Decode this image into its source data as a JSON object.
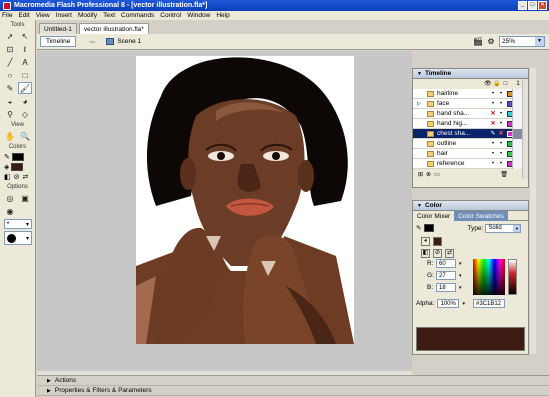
{
  "window": {
    "title": "Macromedia Flash Professional 8 - [vector illustration.fla*]"
  },
  "menu": [
    "File",
    "Edit",
    "View",
    "Insert",
    "Modify",
    "Text",
    "Commands",
    "Control",
    "Window",
    "Help"
  ],
  "tools": {
    "label": "Tools",
    "view_label": "View",
    "colors_label": "Colors",
    "options_label": "Options"
  },
  "doc_tabs": [
    {
      "label": "Untitled-1"
    },
    {
      "label": "vector illustration.fla*"
    }
  ],
  "edit_bar": {
    "timeline_button": "Timeline",
    "scene": "Scene 1",
    "zoom": "25%"
  },
  "timeline": {
    "title": "Timeline",
    "layers": [
      {
        "name": "hairline"
      },
      {
        "name": "face"
      },
      {
        "name": "hand sha..."
      },
      {
        "name": "hand hig..."
      },
      {
        "name": "chest sha..."
      },
      {
        "name": "outline"
      },
      {
        "name": "hair"
      },
      {
        "name": "reference"
      }
    ]
  },
  "color_panel": {
    "title": "Color",
    "tab_mixer": "Color Mixer",
    "tab_swatches": "Color Swatches",
    "type_label": "Type:",
    "type_value": "Solid",
    "r_label": "R:",
    "r_value": "60",
    "g_label": "G:",
    "g_value": "27",
    "b_label": "B:",
    "b_value": "18",
    "alpha_label": "Alpha:",
    "alpha_value": "100%",
    "hex_value": "#3C1B12",
    "current_color": "#3C1B12"
  },
  "bottom_panels": {
    "actions": "Actions",
    "properties": "Properties & Filters & Parameters"
  }
}
